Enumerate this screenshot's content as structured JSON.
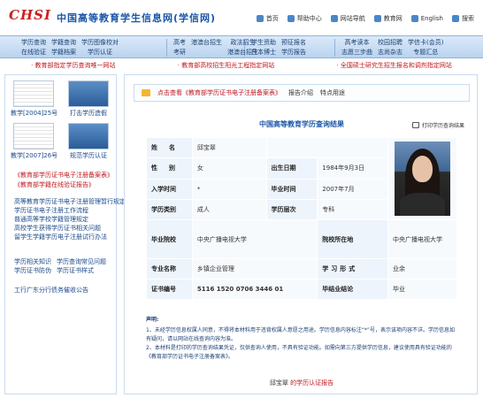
{
  "header": {
    "logo": "CHSI",
    "site_title": "中国高等教育学生信息网(学信网)",
    "links": [
      {
        "label": "首页",
        "icon": "home-icon"
      },
      {
        "label": "帮助中心",
        "icon": "help-icon"
      },
      {
        "label": "网站导航",
        "icon": "map-icon"
      },
      {
        "label": "教育网",
        "icon": "edu-icon"
      },
      {
        "label": "English",
        "icon": "flag-icon"
      },
      {
        "label": "搜索",
        "icon": "search-icon"
      }
    ]
  },
  "nav": {
    "groups": [
      [
        [
          "学历查询",
          "在线验证"
        ],
        [
          "学籍查询",
          "学籍档案"
        ],
        [
          "学历图像校对",
          "学历认证"
        ]
      ],
      [
        [
          "高考",
          "考研"
        ],
        [
          "港澳台招生",
          ""
        ],
        [
          "政法招生",
          "港澳台招生"
        ]
      ],
      [
        [
          "学生资助",
          "日本博士"
        ],
        [
          "预征报名",
          "学历报告"
        ]
      ],
      [
        [
          "高考读本",
          "志愿三步曲"
        ],
        [
          "校园招聘",
          "志尚杂志"
        ],
        [
          "学信卡(会员)",
          "专题汇总"
        ]
      ]
    ]
  },
  "announcements": [
    "· 教育部指定学历查询唯一网站",
    "· 教育部高校招生阳光工程指定网站",
    "· 全国硕士研究生招生报名和调剂指定网站"
  ],
  "sidebar": {
    "thumbs": [
      {
        "caption": "教学[2004]25号",
        "kind": "doc"
      },
      {
        "caption": "打击学历造假",
        "kind": "photo"
      },
      {
        "caption": "教学[2007]26号",
        "kind": "doc"
      },
      {
        "caption": "规范学历认证",
        "kind": "photo"
      }
    ],
    "red_links": [
      "《教育部学历证书电子注册备案表》",
      "《教育部学籍在线验证报告》"
    ],
    "blue_links_1": [
      "高等教育学历证书电子注册管理暂行规定",
      "学历证书电子注册工作流程",
      "普通高等学校学籍管理规定",
      "高校学生获得学历证书相关问题",
      "留学生学籍学历电子注册试行办法"
    ],
    "blue_pairs": [
      [
        "学历相关知识",
        "学历查询常见问题"
      ],
      [
        "学历证书防伪",
        "学历证书样式"
      ]
    ],
    "blue_link_3": "工行广东分行债务催收公告"
  },
  "main": {
    "notice": {
      "red": "点击查看《教育部学历证书电子注册备案表》",
      "plain_1": "报告介绍",
      "plain_2": "特点用途"
    },
    "title": "中国高等教育学历查询结果",
    "print_label": "打印学历查询结果",
    "labels": {
      "name": "姓　名",
      "gender": "性　别",
      "birth": "出生日期",
      "enroll": "入学时间",
      "grad": "毕业时间",
      "edu_type": "学历类别",
      "edu_level": "学历层次",
      "school": "毕业院校",
      "school_loc": "院校所在地",
      "major": "专业名称",
      "study_form": "学习形式",
      "cert_no": "证书编号",
      "conclusion": "毕结业结论"
    },
    "values": {
      "name": "邱宝翠",
      "gender": "女",
      "birth": "1984年9月3日",
      "enroll": "*",
      "grad": "2007年7月",
      "edu_type": "成人",
      "edu_level": "专科",
      "school": "中央广播电视大学",
      "school_loc": "中央广播电视大学",
      "major": "乡镇企业管理",
      "study_form": "业余",
      "cert_no": "5116 1520 0706 3446 01",
      "conclusion": "毕业"
    },
    "declaration": {
      "head": "声明:",
      "p1": "1、未经学历信息权属人同意，不得将本材料用于违背权属人意愿之用途。学历信息内容标注“*”号，表示该项内容不详。学历信息如有疑问，请以网站在线查询内容为准。",
      "p2": "2、本材料是打印的学历查询结果凭证，仅供查询人使用，不具有验证功能。如需向第三方提供学历信息，建议使用具有验证功能的《教育部学历证书电子注册备案表》。"
    },
    "footer": {
      "name": "邱宝翠",
      "suffix": "的学历认证报告"
    }
  }
}
